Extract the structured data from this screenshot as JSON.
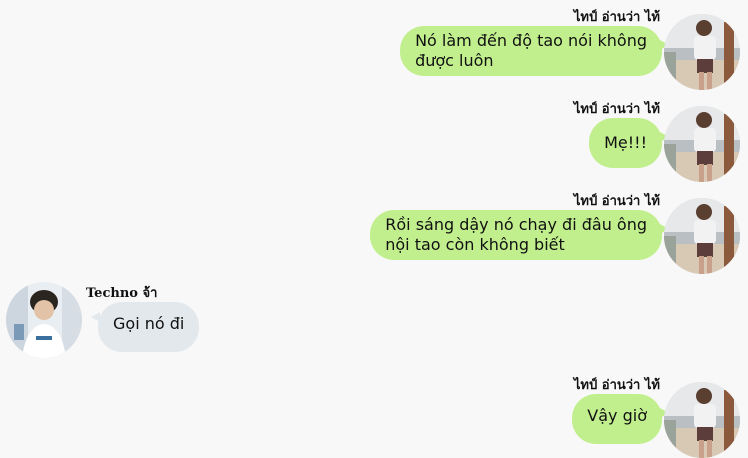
{
  "messages": [
    {
      "side": "right",
      "sender": "ไทป์ อ่านว่า ไท้",
      "text_lines": [
        "Nó làm đến độ tao nói không",
        "được luôn"
      ]
    },
    {
      "side": "right",
      "sender": "ไทป์ อ่านว่า ไท้",
      "text_lines": [
        "Mẹ!!!"
      ]
    },
    {
      "side": "right",
      "sender": "ไทป์ อ่านว่า ไท้",
      "text_lines": [
        "Rồi sáng dậy nó chạy đi đâu ông",
        "nội tao còn không biết"
      ]
    },
    {
      "side": "left",
      "sender": "Techno จ้า",
      "text_lines": [
        "Gọi nó đi"
      ]
    },
    {
      "side": "right",
      "sender": "ไทป์ อ่านว่า ไท้",
      "text_lines": [
        "Vậy giờ"
      ]
    }
  ],
  "colors": {
    "right_bubble": "#c2ef8e",
    "left_bubble": "#e3e8ec",
    "background": "#f8f8f8"
  },
  "avatars": {
    "right": "beach-photo-avatar",
    "left": "portrait-photo-avatar"
  }
}
